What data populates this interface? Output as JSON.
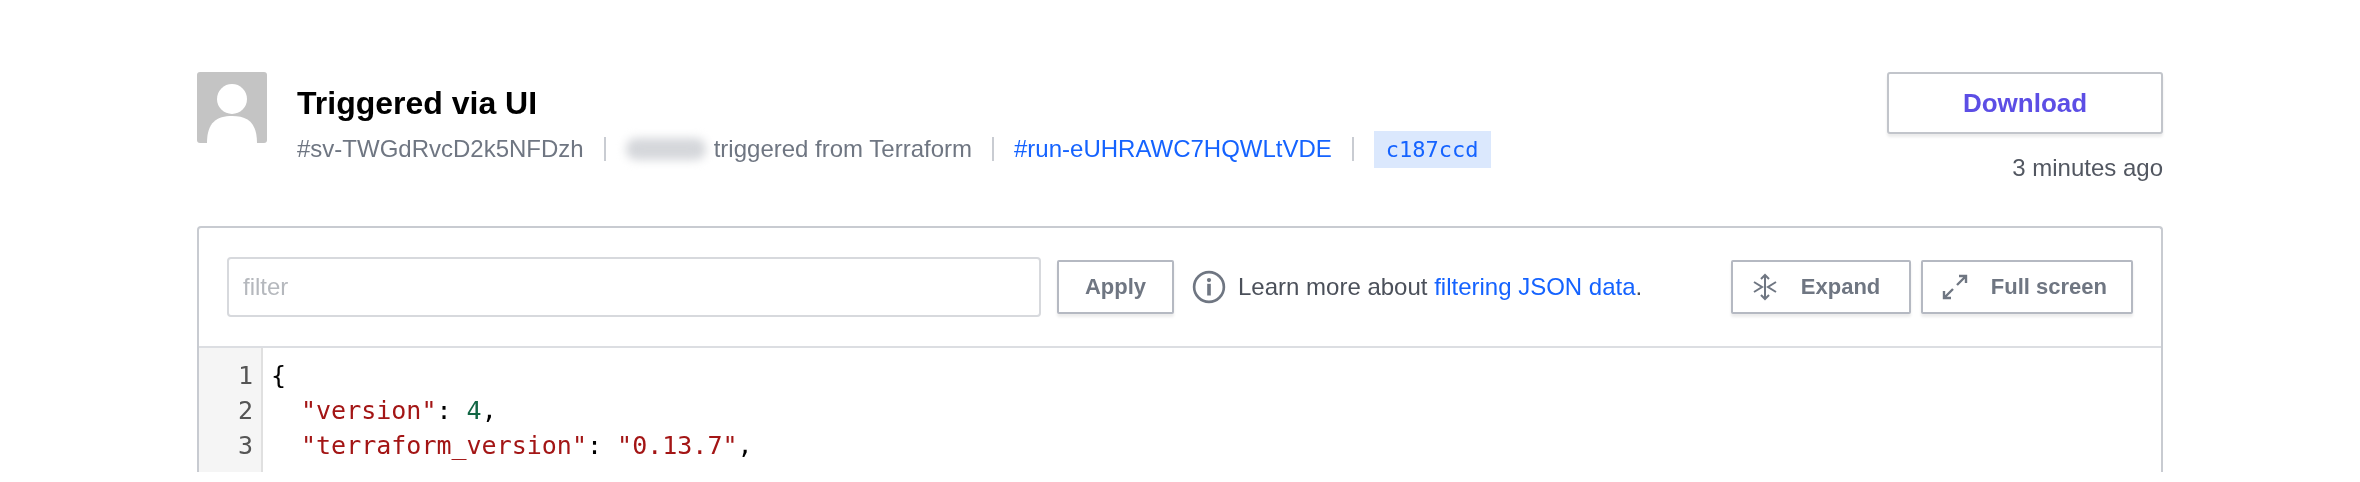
{
  "header": {
    "title": "Triggered via UI",
    "meta": [
      {
        "kind": "text",
        "text": "#sv-TWGdRvcD2k5NFDzh"
      },
      {
        "kind": "redacted-text",
        "text": "triggered from Terraform"
      },
      {
        "kind": "link",
        "text": "#run-eUHRAWC7HQWLtVDE"
      },
      {
        "kind": "commit",
        "text": "c187ccd"
      }
    ],
    "download_button": "Download",
    "time": "3 minutes ago"
  },
  "toolbar": {
    "filter": {
      "placeholder": "filter"
    },
    "apply_button": "Apply",
    "info_text": "Learn more about",
    "info_link": "filtering JSON data",
    "info_end": ".",
    "buttons": [
      {
        "kind": "expand",
        "label": "Expand"
      },
      {
        "kind": "fullscreen",
        "label": "Full screen"
      }
    ]
  },
  "code": {
    "lines": [
      {
        "number": "1",
        "tokens": [
          {
            "kind": "punct",
            "text": "{"
          }
        ]
      },
      {
        "number": "2",
        "indented": true,
        "tokens": [
          {
            "kind": "string",
            "text": "\"version\""
          },
          {
            "kind": "punct",
            "text": ": "
          },
          {
            "kind": "number",
            "text": "4"
          },
          {
            "kind": "punct",
            "text": ","
          }
        ]
      },
      {
        "number": "3",
        "indented": true,
        "tokens": [
          {
            "kind": "string",
            "text": "\"terraform_version\""
          },
          {
            "kind": "punct",
            "text": ": "
          },
          {
            "kind": "string",
            "text": "\"0.13.7\""
          },
          {
            "kind": "punct",
            "text": ","
          }
        ]
      }
    ]
  }
}
